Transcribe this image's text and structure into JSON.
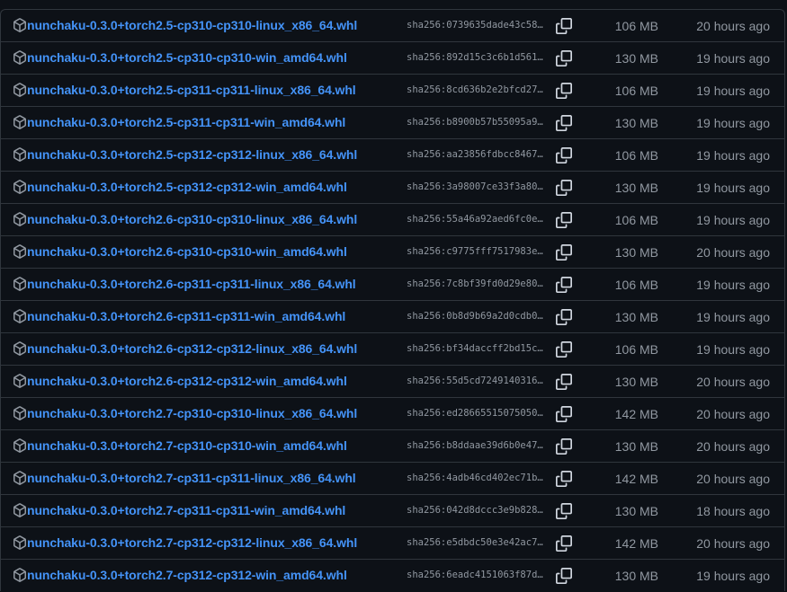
{
  "colors": {
    "background": "#0d1117",
    "border": "#30363d",
    "link": "#4493f8",
    "muted": "#9198a1"
  },
  "icons": {
    "package": "package-icon",
    "copy": "copy-icon"
  },
  "assets": [
    {
      "name": "nunchaku-0.3.0+torch2.5-cp310-cp310-linux_x86_64.whl",
      "sha": "sha256:0739635dade43c58…",
      "size": "106 MB",
      "time": "20 hours ago"
    },
    {
      "name": "nunchaku-0.3.0+torch2.5-cp310-cp310-win_amd64.whl",
      "sha": "sha256:892d15c3c6b1d561…",
      "size": "130 MB",
      "time": "19 hours ago"
    },
    {
      "name": "nunchaku-0.3.0+torch2.5-cp311-cp311-linux_x86_64.whl",
      "sha": "sha256:8cd636b2e2bfcd27…",
      "size": "106 MB",
      "time": "19 hours ago"
    },
    {
      "name": "nunchaku-0.3.0+torch2.5-cp311-cp311-win_amd64.whl",
      "sha": "sha256:b8900b57b55095a9…",
      "size": "130 MB",
      "time": "19 hours ago"
    },
    {
      "name": "nunchaku-0.3.0+torch2.5-cp312-cp312-linux_x86_64.whl",
      "sha": "sha256:aa23856fdbcc8467…",
      "size": "106 MB",
      "time": "19 hours ago"
    },
    {
      "name": "nunchaku-0.3.0+torch2.5-cp312-cp312-win_amd64.whl",
      "sha": "sha256:3a98007ce33f3a80…",
      "size": "130 MB",
      "time": "19 hours ago"
    },
    {
      "name": "nunchaku-0.3.0+torch2.6-cp310-cp310-linux_x86_64.whl",
      "sha": "sha256:55a46a92aed6fc0e…",
      "size": "106 MB",
      "time": "19 hours ago"
    },
    {
      "name": "nunchaku-0.3.0+torch2.6-cp310-cp310-win_amd64.whl",
      "sha": "sha256:c9775fff7517983e…",
      "size": "130 MB",
      "time": "20 hours ago"
    },
    {
      "name": "nunchaku-0.3.0+torch2.6-cp311-cp311-linux_x86_64.whl",
      "sha": "sha256:7c8bf39fd0d29e80…",
      "size": "106 MB",
      "time": "19 hours ago"
    },
    {
      "name": "nunchaku-0.3.0+torch2.6-cp311-cp311-win_amd64.whl",
      "sha": "sha256:0b8d9b69a2d0cdb0…",
      "size": "130 MB",
      "time": "19 hours ago"
    },
    {
      "name": "nunchaku-0.3.0+torch2.6-cp312-cp312-linux_x86_64.whl",
      "sha": "sha256:bf34daccff2bd15c…",
      "size": "106 MB",
      "time": "19 hours ago"
    },
    {
      "name": "nunchaku-0.3.0+torch2.6-cp312-cp312-win_amd64.whl",
      "sha": "sha256:55d5cd7249140316…",
      "size": "130 MB",
      "time": "20 hours ago"
    },
    {
      "name": "nunchaku-0.3.0+torch2.7-cp310-cp310-linux_x86_64.whl",
      "sha": "sha256:ed28665515075050…",
      "size": "142 MB",
      "time": "20 hours ago"
    },
    {
      "name": "nunchaku-0.3.0+torch2.7-cp310-cp310-win_amd64.whl",
      "sha": "sha256:b8ddaae39d6b0e47…",
      "size": "130 MB",
      "time": "20 hours ago"
    },
    {
      "name": "nunchaku-0.3.0+torch2.7-cp311-cp311-linux_x86_64.whl",
      "sha": "sha256:4adb46cd402ec71b…",
      "size": "142 MB",
      "time": "20 hours ago"
    },
    {
      "name": "nunchaku-0.3.0+torch2.7-cp311-cp311-win_amd64.whl",
      "sha": "sha256:042d8dccc3e9b828…",
      "size": "130 MB",
      "time": "18 hours ago"
    },
    {
      "name": "nunchaku-0.3.0+torch2.7-cp312-cp312-linux_x86_64.whl",
      "sha": "sha256:e5dbdc50e3e42ac7…",
      "size": "142 MB",
      "time": "20 hours ago"
    },
    {
      "name": "nunchaku-0.3.0+torch2.7-cp312-cp312-win_amd64.whl",
      "sha": "sha256:6eadc4151063f87d…",
      "size": "130 MB",
      "time": "19 hours ago"
    }
  ]
}
